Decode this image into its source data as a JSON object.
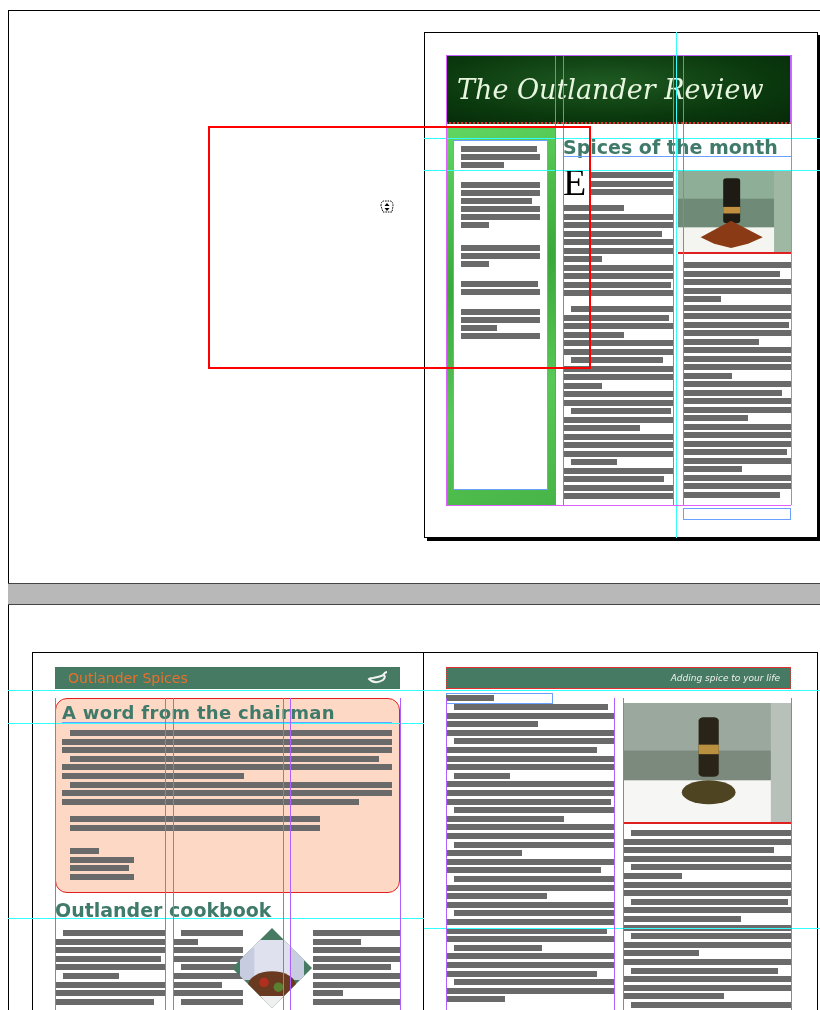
{
  "top_page": {
    "masthead": "The Outlander Review",
    "headline": "Spices of the month",
    "drop_cap": "E"
  },
  "bottom_spread": {
    "left_page": {
      "banner": "Outlander Spices",
      "heading": "A word from the chairman",
      "section": "Outlander cookbook"
    },
    "right_page": {
      "banner": "Adding spice to your life"
    }
  }
}
